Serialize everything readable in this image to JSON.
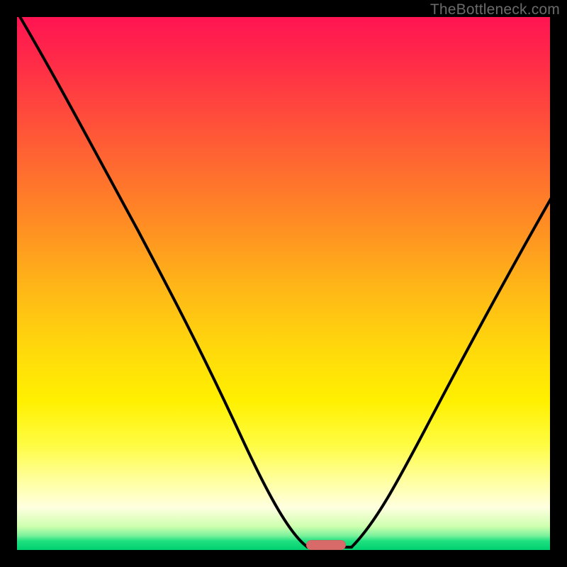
{
  "watermark": {
    "text": "TheBottleneck.com"
  },
  "accent": {
    "pill_color": "#d86a6a",
    "curve_color": "#000000"
  },
  "chart_data": {
    "type": "line",
    "title": "",
    "xlabel": "",
    "ylabel": "",
    "xlim": [
      0,
      100
    ],
    "ylim": [
      0,
      100
    ],
    "grid": false,
    "legend": false,
    "background_gradient": {
      "top_color": "#ff1452",
      "bottom_color": "#00d070"
    },
    "series": [
      {
        "name": "bottleneck-curve",
        "x": [
          0,
          8,
          16,
          24,
          32,
          40,
          46,
          50,
          54,
          58,
          62,
          68,
          74,
          80,
          86,
          92,
          100
        ],
        "y": [
          100,
          86,
          72,
          58,
          46,
          32,
          20,
          10,
          3,
          0,
          0,
          6,
          16,
          28,
          40,
          52,
          68
        ]
      }
    ],
    "marker": {
      "name": "optimal-point",
      "x": 57,
      "y": 0,
      "shape": "pill",
      "color": "#d86a6a"
    },
    "notes": "y=0 is the bottom green edge (best / no bottleneck), y=100 is the top red edge (worst). The curve dips to y≈0 near x≈57 and rises on both sides."
  }
}
